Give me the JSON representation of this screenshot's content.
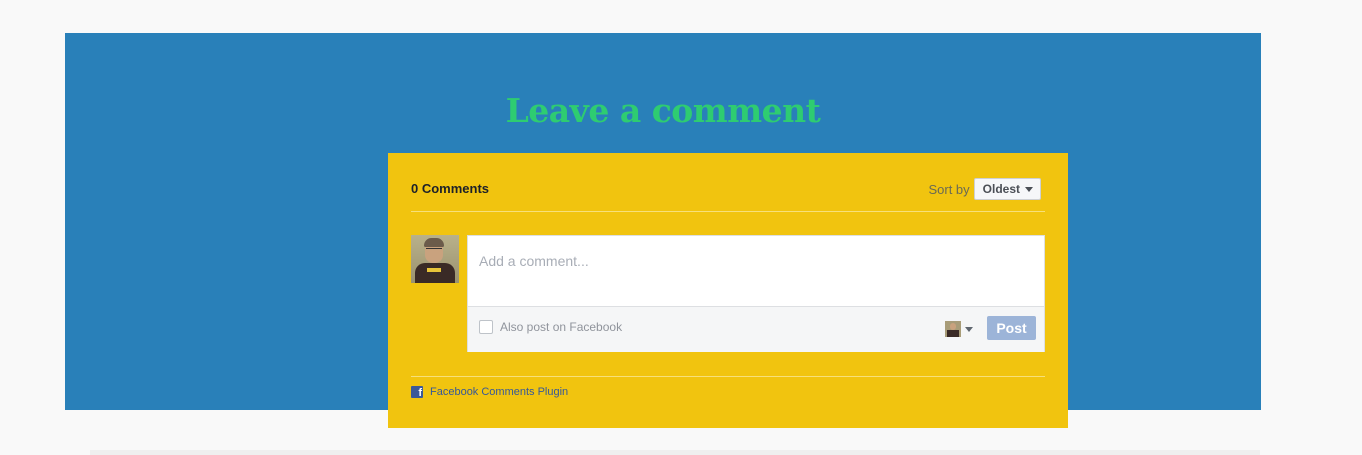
{
  "section": {
    "title": "Leave a comment"
  },
  "comments": {
    "count_label": "0 Comments",
    "sort_label": "Sort by",
    "sort_value": "Oldest",
    "input_placeholder": "Add a comment...",
    "also_post_label": "Also post on Facebook",
    "post_button": "Post",
    "plugin_label": "Facebook Comments Plugin",
    "plugin_icon_glyph": "f"
  },
  "icons": {
    "avatar": "user-avatar",
    "sort_caret": "chevron-down-icon",
    "identity_caret": "chevron-down-icon",
    "plugin": "facebook-icon"
  },
  "colors": {
    "section_background": "#2980b9",
    "title": "#2ecc71",
    "plugin_background": "#f1c40f",
    "post_button": "#9cb4d8",
    "facebook_blue": "#3b5998"
  }
}
